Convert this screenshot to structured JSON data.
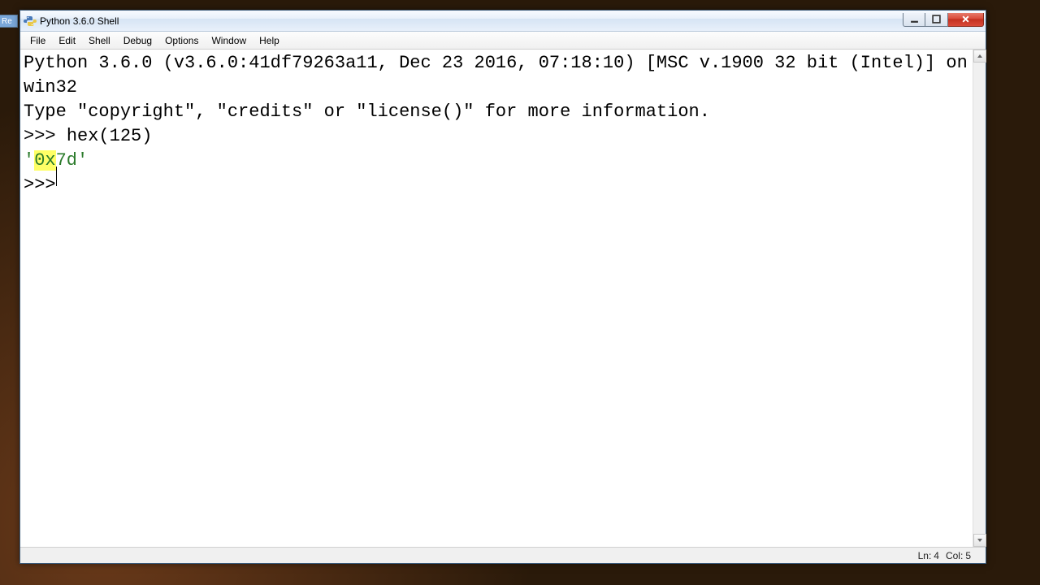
{
  "desktop": {
    "left_fragment": "Re"
  },
  "window": {
    "title": "Python 3.6.0 Shell"
  },
  "menubar": {
    "items": [
      "File",
      "Edit",
      "Shell",
      "Debug",
      "Options",
      "Window",
      "Help"
    ]
  },
  "shell": {
    "banner_line1": "Python 3.6.0 (v3.6.0:41df79263a11, Dec 23 2016, 07:18:10) [MSC v.1900 32 bit (Intel)] on win32",
    "banner_line2": "Type \"copyright\", \"credits\" or \"license()\" for more information.",
    "prompt": ">>> ",
    "input1": "hex(125)",
    "output_q1": "'",
    "output_hl": "0x",
    "output_rest": "7d",
    "output_q2": "'",
    "prompt2": ">>> "
  },
  "statusbar": {
    "ln_label": "Ln:",
    "ln_value": "4",
    "col_label": "Col:",
    "col_value": "5"
  }
}
